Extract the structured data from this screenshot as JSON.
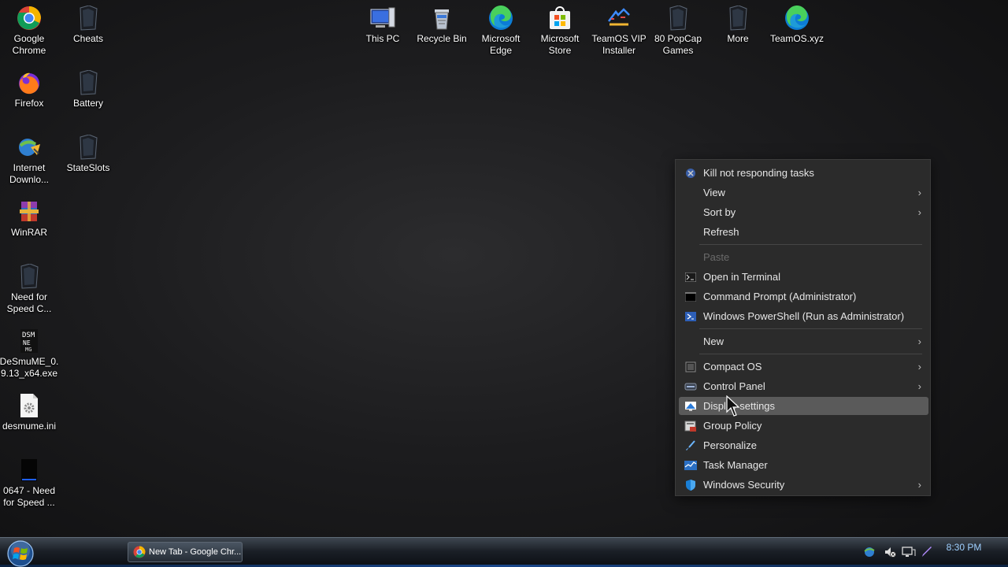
{
  "desktop": {
    "left_icons": [
      {
        "label": "Google\nChrome",
        "icon": "chrome-icon"
      },
      {
        "label": "Cheats",
        "icon": "folder-dark-icon"
      },
      {
        "label": "Firefox",
        "icon": "firefox-icon"
      },
      {
        "label": "Battery",
        "icon": "folder-dark-icon"
      },
      {
        "label": "Internet\nDownlo...",
        "icon": "idm-icon"
      },
      {
        "label": "StateSlots",
        "icon": "folder-dark-icon"
      },
      {
        "label": "WinRAR",
        "icon": "winrar-icon"
      },
      {
        "label": "Need for\nSpeed C...",
        "icon": "folder-dark-icon"
      },
      {
        "label": "DeSmuME_0.\n9.13_x64.exe",
        "icon": "desmume-icon"
      },
      {
        "label": "desmume.ini",
        "icon": "settings-file-icon"
      },
      {
        "label": "0647 - Need\nfor Speed ...",
        "icon": "game-file-icon"
      }
    ],
    "top_icons": [
      {
        "label": "This PC",
        "icon": "computer-icon"
      },
      {
        "label": "Recycle Bin",
        "icon": "recycle-bin-icon"
      },
      {
        "label": "Microsoft\nEdge",
        "icon": "edge-icon"
      },
      {
        "label": "Microsoft\nStore",
        "icon": "store-icon"
      },
      {
        "label": "TeamOS VIP\nInstaller",
        "icon": "installer-icon"
      },
      {
        "label": "80 PopCap\nGames",
        "icon": "folder-dark-icon"
      },
      {
        "label": "More",
        "icon": "folder-dark-icon"
      },
      {
        "label": "TeamOS.xyz",
        "icon": "edge-icon"
      }
    ]
  },
  "context_menu": {
    "items": [
      {
        "label": "Kill not responding tasks",
        "icon": "kill-task-icon",
        "submenu": false,
        "disabled": false
      },
      {
        "label": "View",
        "icon": "",
        "submenu": true,
        "disabled": false
      },
      {
        "label": "Sort by",
        "icon": "",
        "submenu": true,
        "disabled": false
      },
      {
        "label": "Refresh",
        "icon": "",
        "submenu": false,
        "disabled": false
      },
      {
        "label": "Paste",
        "icon": "",
        "submenu": false,
        "disabled": true
      },
      {
        "label": "Open in Terminal",
        "icon": "terminal-icon",
        "submenu": false,
        "disabled": false
      },
      {
        "label": "Command Prompt (Administrator)",
        "icon": "cmd-icon",
        "submenu": false,
        "disabled": false
      },
      {
        "label": "Windows PowerShell (Run as Administrator)",
        "icon": "powershell-icon",
        "submenu": false,
        "disabled": false
      },
      {
        "label": "New",
        "icon": "",
        "submenu": true,
        "disabled": false
      },
      {
        "label": "Compact OS",
        "icon": "compact-os-icon",
        "submenu": true,
        "disabled": false
      },
      {
        "label": "Control Panel",
        "icon": "control-panel-icon",
        "submenu": true,
        "disabled": false
      },
      {
        "label": "Display settings",
        "icon": "display-icon",
        "submenu": false,
        "disabled": false,
        "highlighted": true
      },
      {
        "label": "Group Policy",
        "icon": "group-policy-icon",
        "submenu": false,
        "disabled": false
      },
      {
        "label": "Personalize",
        "icon": "brush-icon",
        "submenu": false,
        "disabled": false
      },
      {
        "label": "Task Manager",
        "icon": "task-manager-icon",
        "submenu": false,
        "disabled": false
      },
      {
        "label": "Windows Security",
        "icon": "shield-icon",
        "submenu": true,
        "disabled": false
      }
    ],
    "submenu_arrow": "›"
  },
  "taskbar": {
    "start_icon": "windows-orb-icon",
    "task_button_label": "New Tab - Google Chr...",
    "clock": "8:30 PM",
    "tray_icons": [
      "idm-tray-icon",
      "volume-muted-icon",
      "network-icon",
      "pen-icon"
    ]
  }
}
